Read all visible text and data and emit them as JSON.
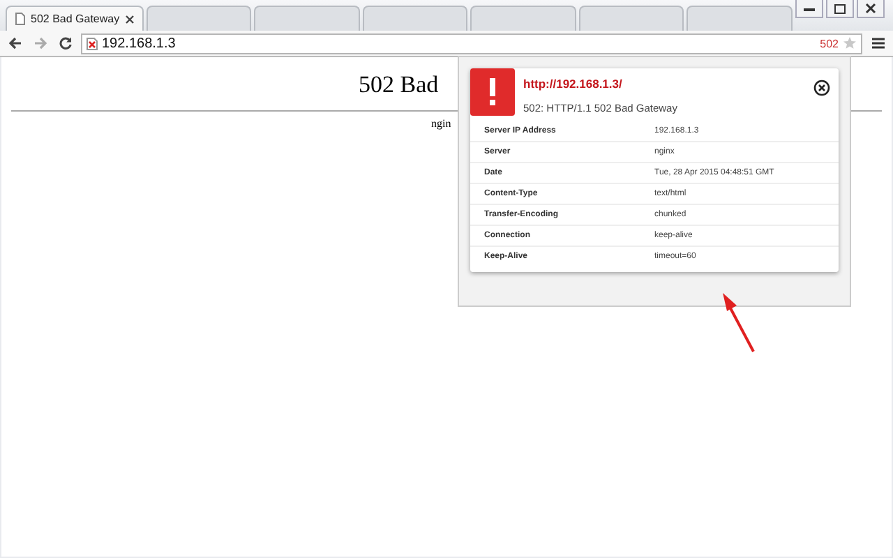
{
  "tabs": [
    {
      "title": "502 Bad Gateway",
      "selected": true
    },
    {
      "selected": false
    },
    {
      "selected": false
    },
    {
      "selected": false
    },
    {
      "selected": false
    },
    {
      "selected": false
    },
    {
      "selected": false
    }
  ],
  "address": {
    "url": "192.168.1.3",
    "status": "502"
  },
  "page": {
    "heading": "502 Bad",
    "footer": "ngin"
  },
  "popup": {
    "url": "http://192.168.1.3/",
    "status_line": "502: HTTP/1.1 502 Bad Gateway",
    "headers": [
      {
        "name": "Server IP Address",
        "value": "192.168.1.3"
      },
      {
        "name": "Server",
        "value": "nginx"
      },
      {
        "name": "Date",
        "value": "Tue, 28 Apr 2015 04:48:51 GMT"
      },
      {
        "name": "Content-Type",
        "value": "text/html"
      },
      {
        "name": "Transfer-Encoding",
        "value": "chunked"
      },
      {
        "name": "Connection",
        "value": "keep-alive"
      },
      {
        "name": "Keep-Alive",
        "value": "timeout=60"
      }
    ]
  }
}
